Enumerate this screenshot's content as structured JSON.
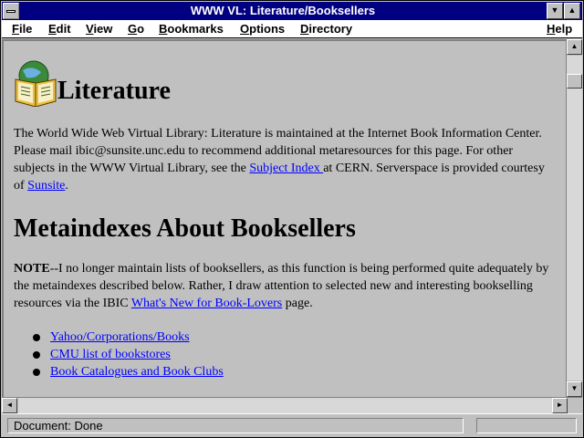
{
  "window": {
    "title": "WWW VL: Literature/Booksellers"
  },
  "menu": {
    "file": "ile",
    "file_key": "F",
    "edit": "dit",
    "edit_key": "E",
    "view": "iew",
    "view_key": "V",
    "go": "o",
    "go_key": "G",
    "bookmarks": "ookmarks",
    "bookmarks_key": "B",
    "options": "ptions",
    "options_key": "O",
    "directory": "irectory",
    "directory_key": "D",
    "help": "elp",
    "help_key": "H"
  },
  "page": {
    "heading": "Literature",
    "intro": {
      "text1": "The World Wide Web Virtual Library: Literature is maintained at the Internet Book Information Center. Please mail ibic@sunsite.unc.edu to recommend additional metaresources for this page. For other subjects in the WWW Virtual Library, see the ",
      "link_subject_index": "Subject Index ",
      "text2": "at CERN. Serverspace is provided courtesy of ",
      "link_sunsite": "Sunsite",
      "text3": "."
    },
    "section_heading": "Metaindexes About Booksellers",
    "note": {
      "label": "NOTE",
      "text1": "--I no longer maintain lists of booksellers, as this function is being performed quite adequately by the metaindexes described below. Rather, I draw attention to selected new and interesting bookselling resources via the IBIC ",
      "link_whats_new": "What's New for Book-Lovers",
      "text2": " page."
    },
    "links": [
      "Yahoo/Corporations/Books",
      "CMU list of bookstores",
      "Book Catalogues and Book Clubs "
    ]
  },
  "status": {
    "text": "Document: Done"
  },
  "colors": {
    "titlebar": "#000080",
    "link": "#0000ff",
    "chrome": "#c0c0c0"
  }
}
